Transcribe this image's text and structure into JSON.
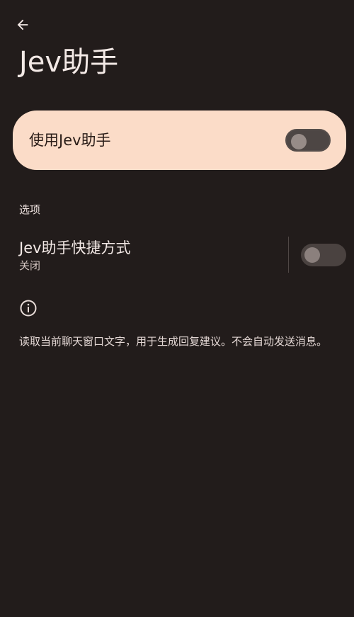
{
  "header": {
    "title": "Jev助手",
    "back_icon": "arrow-back-icon"
  },
  "main_switch": {
    "label": "使用Jev助手",
    "checked": false
  },
  "options": {
    "section_title": "选项",
    "shortcut": {
      "title": "Jev助手快捷方式",
      "subtitle": "关闭",
      "checked": false
    }
  },
  "info": {
    "icon": "info-icon",
    "text": "读取当前聊天窗口文字，用于生成回复建议。不会自动发送消息。"
  },
  "colors": {
    "background": "#221c1b",
    "card": "#fbdcc8",
    "text_primary": "#f3e9e6",
    "switch_track": "#4d4644",
    "switch_thumb": "#978c88"
  }
}
